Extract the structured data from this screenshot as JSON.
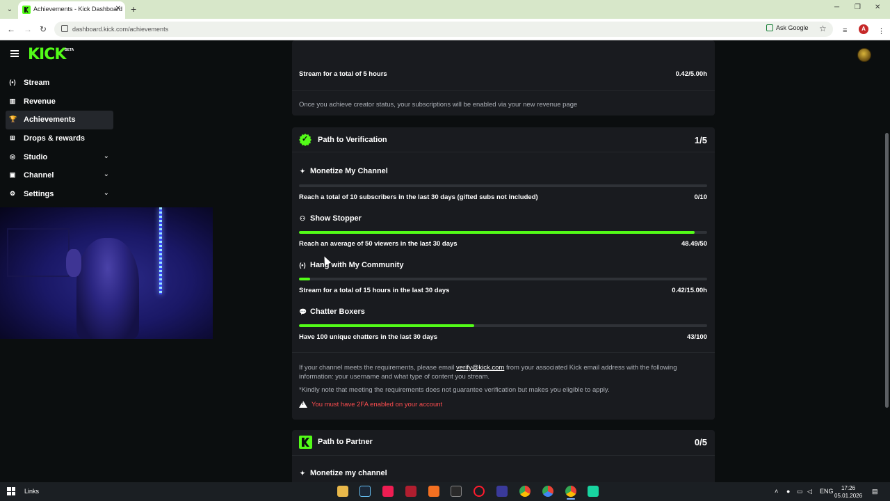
{
  "browser": {
    "tab_title": "Achievements - Kick Dashboard",
    "url": "dashboard.kick.com/achievements",
    "ask_google": "Ask Google",
    "profile_initial": "A"
  },
  "app": {
    "logo": "KICK",
    "logo_badge": "BETA"
  },
  "sidebar": {
    "items": [
      {
        "label": "Stream",
        "icon": "broadcast-icon",
        "glyph": "(•)"
      },
      {
        "label": "Revenue",
        "icon": "chart-icon",
        "glyph": "▥"
      },
      {
        "label": "Achievements",
        "icon": "trophy-icon",
        "glyph": "🏆",
        "active": true
      },
      {
        "label": "Drops & rewards",
        "icon": "gift-icon",
        "glyph": "⊞"
      },
      {
        "label": "Studio",
        "icon": "studio-icon",
        "glyph": "◎",
        "expandable": true
      },
      {
        "label": "Channel",
        "icon": "channel-icon",
        "glyph": "▣",
        "expandable": true
      },
      {
        "label": "Settings",
        "icon": "gear-icon",
        "glyph": "⚙",
        "expandable": true
      }
    ]
  },
  "creator_card": {
    "stream_desc": "Stream for a total of 5 hours",
    "stream_value": "0.42/5.00h",
    "note": "Once you achieve creator status, your subscriptions will be enabled via your new revenue page"
  },
  "verification": {
    "title": "Path to Verification",
    "count": "1/5",
    "achievements": [
      {
        "title": "Monetize My Channel",
        "icon": "sparkle-icon",
        "glyph": "✦",
        "desc": "Reach a total of 10 subscribers in the last 30 days (gifted subs not included)",
        "value": "0/10",
        "progress": 0
      },
      {
        "title": "Show Stopper",
        "icon": "viewers-icon",
        "glyph": "⚇",
        "desc": "Reach an average of 50 viewers in the last 30 days",
        "value": "48.49/50",
        "progress": 0.9698
      },
      {
        "title": "Hang with My Community",
        "icon": "broadcast-icon",
        "glyph": "(•)",
        "desc": "Stream for a total of 15 hours in the last 30 days",
        "value": "0.42/15.00h",
        "progress": 0.028
      },
      {
        "title": "Chatter Boxers",
        "icon": "chat-icon",
        "glyph": "💬",
        "desc": "Have 100 unique chatters in the last 30 days",
        "value": "43/100",
        "progress": 0.43
      }
    ],
    "info_before": "If your channel meets the requirements, please email",
    "info_link": "verify@kick.com",
    "info_after": "from your associated Kick email address with the following",
    "info_line2": "information: your username and what type of content you stream.",
    "note": "*Kindly note that meeting the requirements does not guarantee verification but makes you eligible to apply.",
    "warning": "You must have 2FA enabled on your account"
  },
  "partner": {
    "title": "Path to Partner",
    "count": "0/5",
    "first_achievement": "Monetize my channel"
  },
  "taskbar": {
    "links_label": "Links",
    "language": "ENG",
    "time": "17:26",
    "date": "05.01.2026"
  },
  "colors": {
    "accent": "#53fc18",
    "warning": "#ff4d4f",
    "card_bg": "#191b1f",
    "page_bg": "#0b0e0f"
  }
}
